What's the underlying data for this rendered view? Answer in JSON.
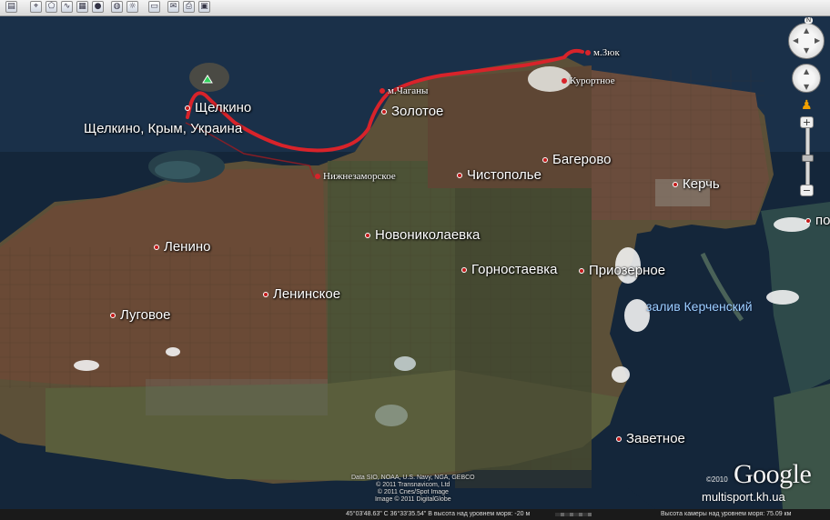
{
  "map": {
    "places": [
      {
        "id": "shchelkino",
        "label": "Щелкино"
      },
      {
        "id": "shchelkino-full",
        "label": "Щелкино, Крым, Украина"
      },
      {
        "id": "zolotoe",
        "label": "Золотое"
      },
      {
        "id": "chistopole",
        "label": "Чистополье"
      },
      {
        "id": "bagerovo",
        "label": "Багерово"
      },
      {
        "id": "kerch",
        "label": "Керчь"
      },
      {
        "id": "novonikolaevka",
        "label": "Новониколаевка"
      },
      {
        "id": "lenino",
        "label": "Ленино"
      },
      {
        "id": "gornostaevka",
        "label": "Горностаевка"
      },
      {
        "id": "priozernoe",
        "label": "Приозерное"
      },
      {
        "id": "leninskoe",
        "label": "Ленинское"
      },
      {
        "id": "lugovoe",
        "label": "Луговое"
      },
      {
        "id": "zavetnoe",
        "label": "Заветное"
      },
      {
        "id": "edge",
        "label": "по"
      }
    ],
    "route_points": [
      {
        "id": "cape-chagany",
        "label": "м.Чаганы"
      },
      {
        "id": "nizhnezamorskoe",
        "label": "Нижнезаморское"
      },
      {
        "id": "cape-zyuk",
        "label": "м.Зюк"
      },
      {
        "id": "kurortnoe",
        "label": "Курортное"
      }
    ],
    "water_label": "залив Керченский",
    "route_color": "#d8232a",
    "credits": [
      "Data SIO, NOAA, U.S. Navy, NGA, GEBCO",
      "© 2011 Transnavicom, Ltd",
      "© 2011 Cnes/Spot Image",
      "Image © 2011 DigitalGlobe"
    ],
    "copyright": "©2010",
    "logo": "Google",
    "watermark": "multisport.kh.ua"
  },
  "status_bar": {
    "coords": "45°03'48.63\" С   36°33'35.54\" В   высота над уровнем моря:   -20 м",
    "eye_alt": "Высота камеры над уровнем моря:    75.09 км"
  },
  "nav": {
    "north": "N"
  },
  "toolbar": {
    "icons": [
      "sidebar-icon",
      "placemark-icon",
      "polygon-icon",
      "path-icon",
      "overlay-icon",
      "tour-icon",
      "planet-icon",
      "ruler-icon",
      "email-icon",
      "print-icon",
      "map-icon"
    ]
  }
}
